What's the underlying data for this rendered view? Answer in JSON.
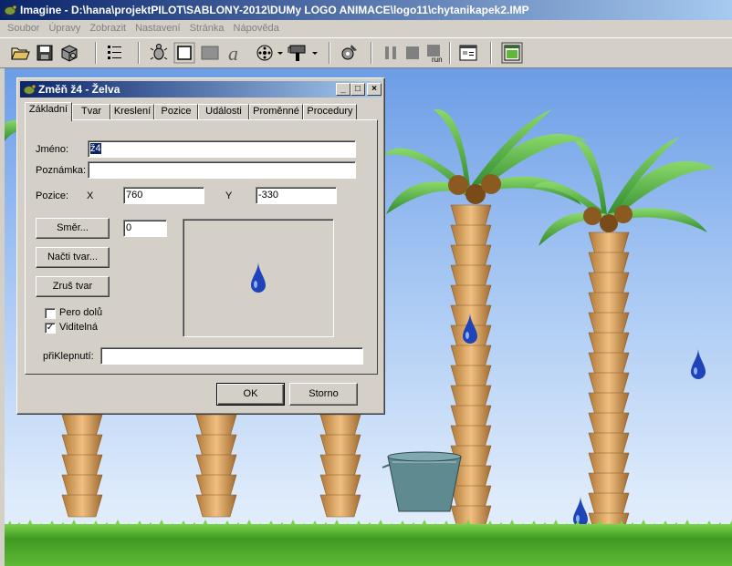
{
  "window": {
    "title": "Imagine - D:\\hana\\projektPILOT\\SABLONY-2012\\DUMy LOGO ANIMACE\\logo11\\chytanikapek2.IMP"
  },
  "menu": [
    "Soubor",
    "Úpravy",
    "Zobrazit",
    "Nastavení",
    "Stránka",
    "Nápověda"
  ],
  "toolbar": {
    "icons": [
      "open-icon",
      "save-icon",
      "package-icon",
      "layout-icon",
      "turtle-icon",
      "rect-outline-icon",
      "rect-fill-icon",
      "text-a-icon",
      "film-icon",
      "paint-icon",
      "gear-icon",
      "pause-icon",
      "stop-icon",
      "run-icon",
      "page-settings-icon",
      "fullscreen-icon"
    ],
    "run_label": "run"
  },
  "dialog": {
    "title": "Změň ž4  - Želva",
    "caption_buttons": {
      "minimize": "_",
      "maximize": "□",
      "close": "×"
    },
    "tabs": [
      "Základní",
      "Tvar",
      "Kreslení",
      "Pozice",
      "Události",
      "Proměnné",
      "Procedury"
    ],
    "active_tab": "Základní",
    "fields": {
      "name_label": "Jméno:",
      "name_value": "ž4",
      "note_label": "Poznámka:",
      "note_value": "",
      "position_label": "Pozice:",
      "x_label": "X",
      "x_value": "760",
      "y_label": "Y",
      "y_value": "-330",
      "direction_value": "0",
      "click_label": "přiKlepnutí:",
      "click_value": ""
    },
    "buttons": {
      "direction": "Směr...",
      "load_shape": "Načti tvar...",
      "clear_shape": "Zruš tvar",
      "ok": "OK",
      "cancel": "Storno"
    },
    "checkboxes": {
      "pen_down": {
        "label": "Pero dolů",
        "checked": false
      },
      "visible": {
        "label": "Viditelná",
        "checked": true,
        "mark": "✓"
      }
    }
  },
  "colors": {
    "title_active": "#0a246a",
    "title_gradient_end": "#a6caf0",
    "face": "#d4d0c8",
    "drop": "#1f43b8"
  }
}
